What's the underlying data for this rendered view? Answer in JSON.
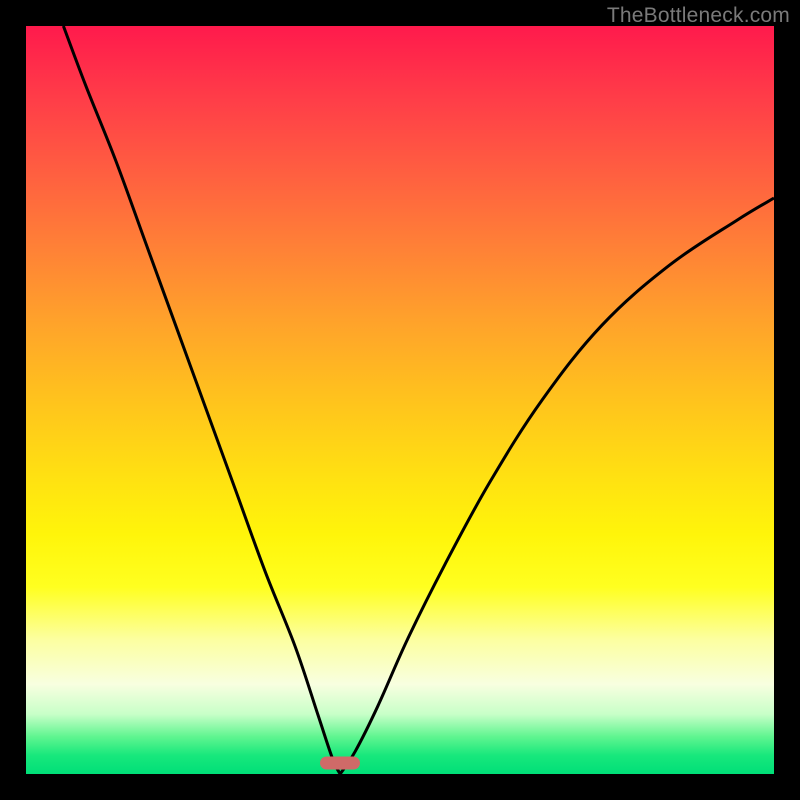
{
  "watermark": "TheBottleneck.com",
  "chart_data": {
    "type": "line",
    "title": "",
    "xlabel": "",
    "ylabel": "",
    "xlim": [
      0,
      100
    ],
    "ylim": [
      0,
      100
    ],
    "grid": false,
    "marker": {
      "x_percent": 42.0,
      "y_percent": 98.5
    },
    "series": [
      {
        "name": "left-curve",
        "x": [
          5,
          8,
          12,
          16,
          20,
          24,
          28,
          32,
          36,
          39,
          41,
          42
        ],
        "y": [
          100,
          92,
          82,
          71,
          60,
          49,
          38,
          27,
          17,
          8,
          2,
          0
        ]
      },
      {
        "name": "right-curve",
        "x": [
          42,
          44,
          47,
          51,
          56,
          62,
          69,
          77,
          86,
          95,
          100
        ],
        "y": [
          0,
          3,
          9,
          18,
          28,
          39,
          50,
          60,
          68,
          74,
          77
        ]
      }
    ],
    "background_gradient": {
      "stops": [
        {
          "pos": 0,
          "color": "#ff1a4c"
        },
        {
          "pos": 50,
          "color": "#ffc31d"
        },
        {
          "pos": 75,
          "color": "#ffff20"
        },
        {
          "pos": 100,
          "color": "#00df78"
        }
      ]
    }
  }
}
